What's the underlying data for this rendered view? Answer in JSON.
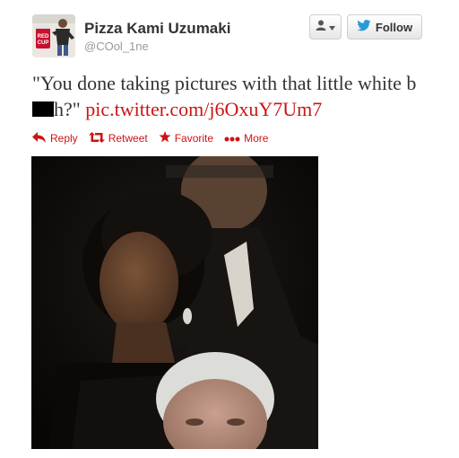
{
  "user": {
    "name": "Pizza Kami Uzumaki",
    "handle": "@COol_1ne"
  },
  "avatar_badge": "RED CUP",
  "follow_button": {
    "label": "Follow"
  },
  "tweet": {
    "text_before": "\"You done taking pictures with that little white b",
    "text_after": "h?\" ",
    "link": "pic.twitter.com/j6OxuY7Um7"
  },
  "actions": {
    "reply": "Reply",
    "retweet": "Retweet",
    "favorite": "Favorite",
    "more": "More"
  },
  "icons": {
    "user": "person-icon",
    "caret": "caret-down-icon",
    "bird": "twitter-bird-icon",
    "reply": "reply-arrow-icon",
    "retweet": "retweet-icon",
    "favorite": "star-icon",
    "more": "ellipsis-icon"
  },
  "colors": {
    "accent": "#cc1414",
    "text": "#333333",
    "muted": "#999999",
    "twitter_blue": "#2b9ad9"
  }
}
